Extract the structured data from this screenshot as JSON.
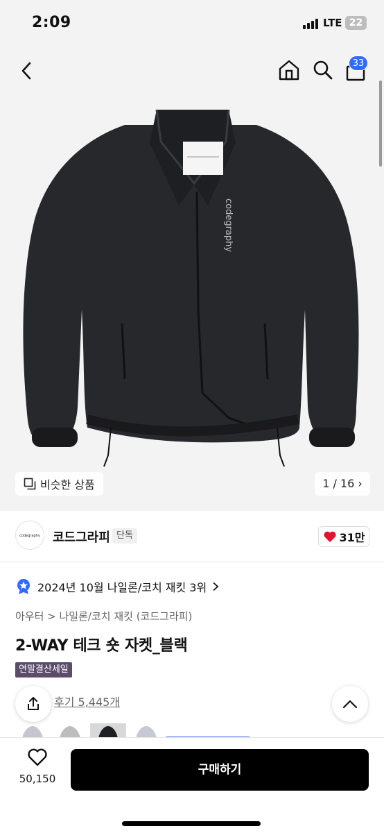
{
  "status_bar": {
    "time": "2:09",
    "network": "LTE",
    "battery": "22"
  },
  "nav": {
    "cart_count": "33",
    "icons": [
      "back-icon",
      "home-icon",
      "search-icon",
      "shopping-bag-icon"
    ]
  },
  "hero": {
    "similar_label": "비슷한 상품",
    "image_counter": "1 / 16",
    "product_image_text": "codegraphy"
  },
  "brand": {
    "logo_text": "codegraphy",
    "name": "코드그라피",
    "exclusive_label": "단독",
    "like_count": "31만"
  },
  "rank": {
    "text": "2024년 10월 나일론/코치 재킷 3위"
  },
  "product": {
    "category": "아우터 > 나일론/코치 재킷 (코드그라피)",
    "title": "2-WAY 테크 숏 자켓_블랙",
    "sale_badge": "연말결산세일",
    "reviews": "후기 5,445개"
  },
  "bottom_bar": {
    "wish_count": "50,150",
    "buy_label": "구매하기"
  },
  "colors": {
    "accent": "#2f6bff",
    "heart": "#e8112d",
    "sale_badge": "#5b4c6b",
    "buy_button": "#000000"
  }
}
